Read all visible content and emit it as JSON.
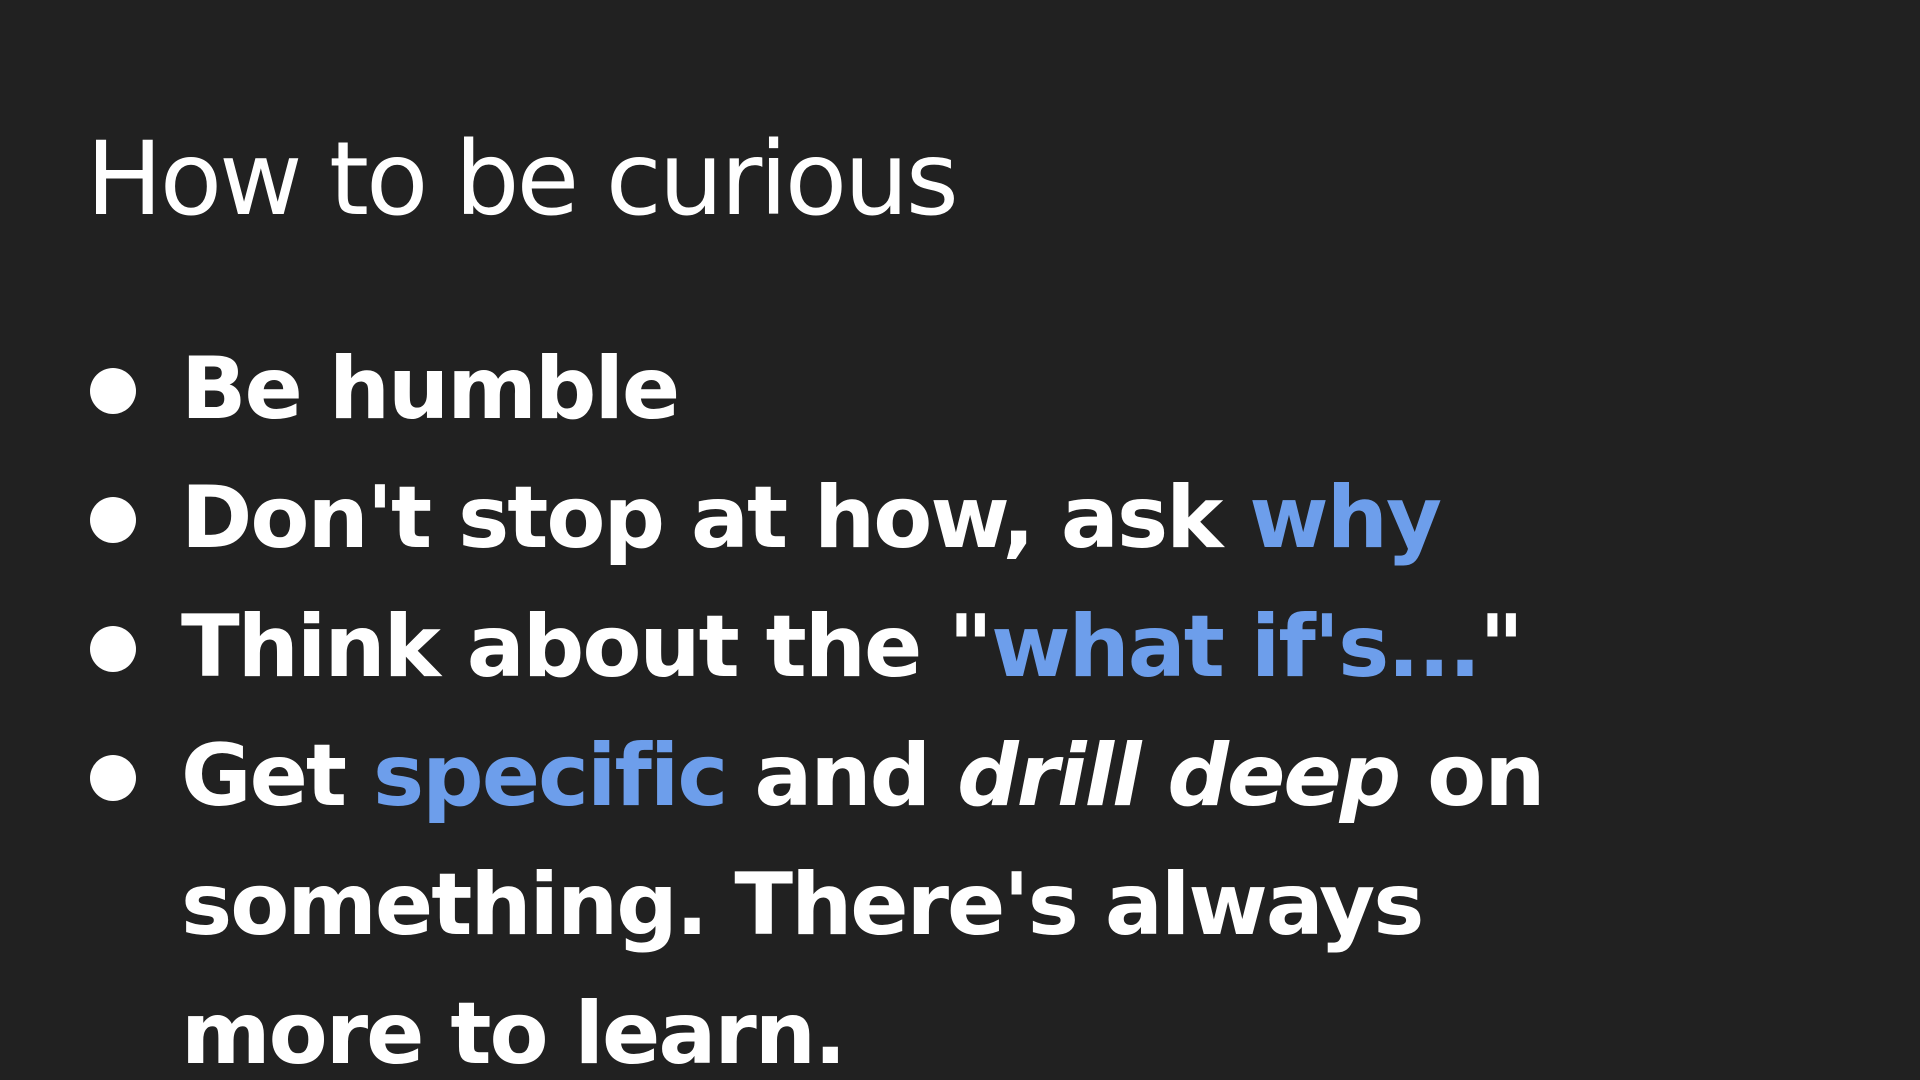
{
  "slide": {
    "title": "How to be curious",
    "accent_color": "#6d9eeb",
    "background_color": "#212121",
    "bullets": [
      {
        "text": "Be humble"
      },
      {
        "text": "Don't stop at how, ask ",
        "accent": "why"
      },
      {
        "pre": "Think about the \"",
        "accent": "what if's...",
        "post": "\""
      },
      {
        "pre": "Get ",
        "accent": "specific",
        "mid": " and ",
        "emphasis": "drill deep",
        "post": " on something. There's always more to learn."
      }
    ]
  }
}
